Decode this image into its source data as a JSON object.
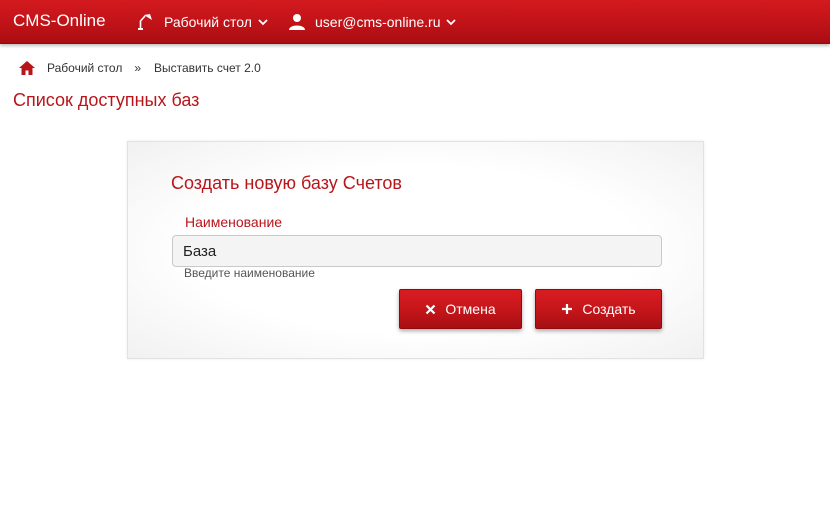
{
  "navbar": {
    "brand": "CMS-Online",
    "desk_label": "Рабочий стол",
    "desk_icon": "lamp-icon",
    "user_label": "user@cms-online.ru",
    "user_icon": "user-icon",
    "chevron_icon": "chevron-down-icon"
  },
  "breadcrumb": {
    "home_icon": "home-icon",
    "items": [
      "Рабочий стол",
      "Выставить счет 2.0"
    ],
    "separator": "»"
  },
  "page": {
    "title": "Список доступных баз"
  },
  "form": {
    "title": "Создать новую базу Счетов",
    "name_label": "Наименование",
    "name_value": "База",
    "name_help": "Введите наименование",
    "cancel_label": "Отмена",
    "cancel_icon": "close-icon",
    "create_label": "Создать",
    "create_icon": "plus-icon"
  },
  "colors": {
    "brand_red": "#be1217",
    "accent_text": "#b8151b"
  }
}
